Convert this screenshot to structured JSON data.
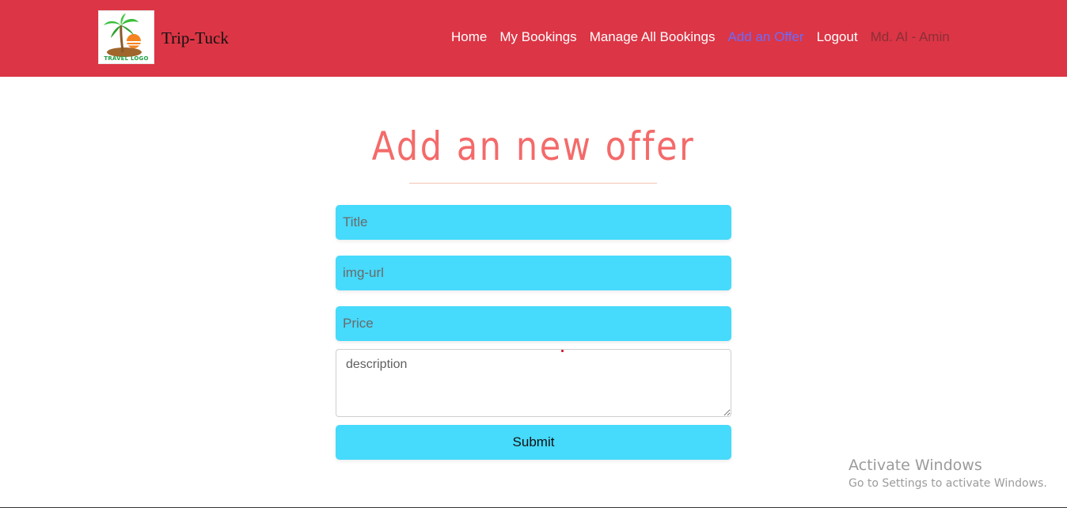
{
  "header": {
    "logo_caption": "TRAVEL LOGO",
    "brand": "Trip-Tuck",
    "nav": {
      "home": "Home",
      "my_bookings": "My Bookings",
      "manage_all": "Manage All Bookings",
      "add_offer": "Add an Offer",
      "logout": "Logout",
      "user": "Md. Al - Amin"
    }
  },
  "main": {
    "heading": "Add an new offer",
    "form": {
      "title_placeholder": "Title",
      "img_url_placeholder": "img-url",
      "price_placeholder": "Price",
      "description_placeholder": "description",
      "submit_label": "Submit"
    }
  },
  "watermark": {
    "title": "Activate Windows",
    "subtitle": "Go to Settings to activate Windows."
  },
  "colors": {
    "header_bg": "#dc3545",
    "accent_input": "#46dafc",
    "heading": "#f46a6a",
    "active_nav": "#6a6cff"
  }
}
